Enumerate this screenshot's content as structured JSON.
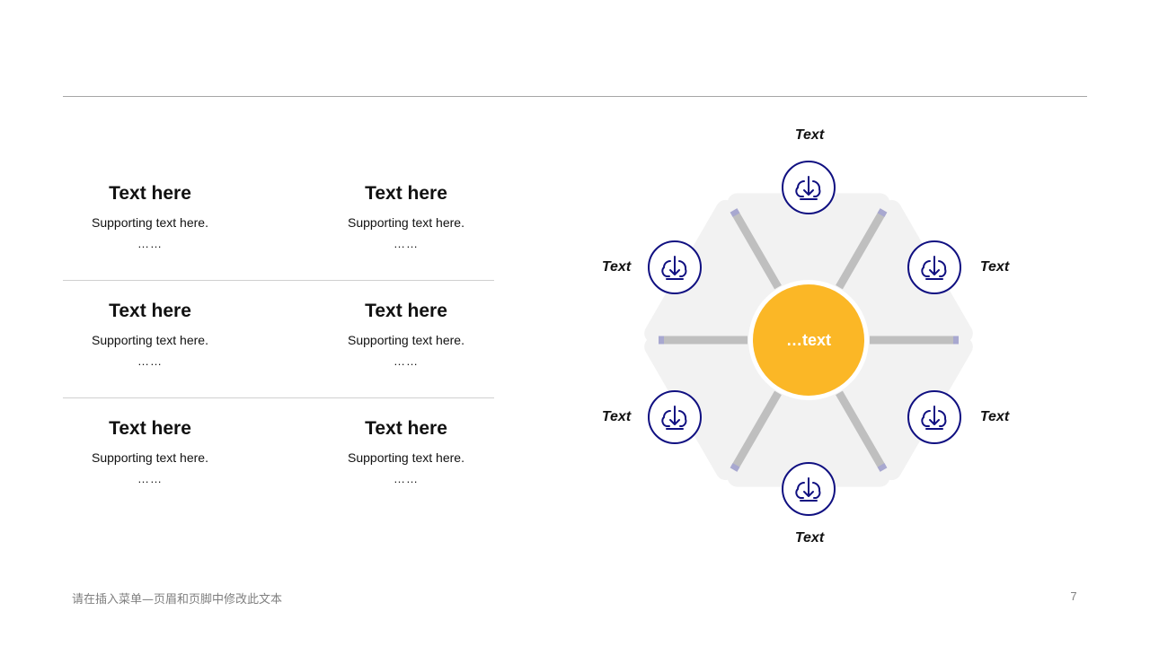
{
  "features": [
    {
      "title": "Text here",
      "body": "Supporting  text here.",
      "dots": "……"
    },
    {
      "title": "Text here",
      "body": "Supporting  text here.",
      "dots": "……"
    },
    {
      "title": "Text here",
      "body": "Supporting  text here.",
      "dots": "……"
    },
    {
      "title": "Text here",
      "body": "Supporting  text here.",
      "dots": "……"
    },
    {
      "title": "Text here",
      "body": "Supporting  text here.",
      "dots": "……"
    },
    {
      "title": "Text here",
      "body": "Supporting  text here.",
      "dots": "……"
    }
  ],
  "diagram": {
    "center_label": "…text",
    "nodes": [
      {
        "label": "Text",
        "icon": "cloud-download-icon"
      },
      {
        "label": "Text",
        "icon": "cloud-download-icon"
      },
      {
        "label": "Text",
        "icon": "cloud-download-icon"
      },
      {
        "label": "Text",
        "icon": "cloud-download-icon"
      },
      {
        "label": "Text",
        "icon": "cloud-download-icon"
      },
      {
        "label": "Text",
        "icon": "cloud-download-icon"
      }
    ],
    "colors": {
      "center": "#FBB726",
      "icon": "#101081",
      "panel": "#F2F2F2",
      "spoke": "#BFBFBF"
    }
  },
  "footer": {
    "text": "请在插入菜单—页眉和页脚中修改此文本",
    "page_number": "7"
  }
}
